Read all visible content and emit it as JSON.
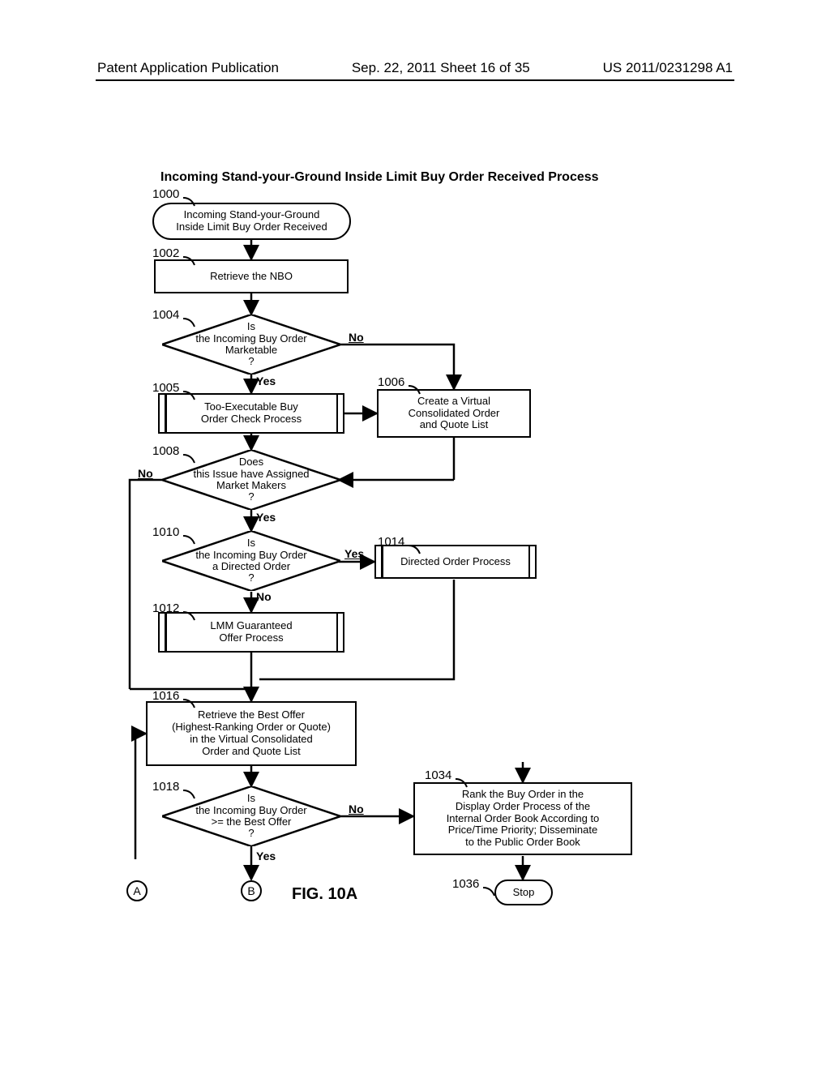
{
  "header": {
    "left": "Patent Application Publication",
    "mid": "Sep. 22, 2011  Sheet 16 of 35",
    "right": "US 2011/0231298 A1"
  },
  "title": "Incoming Stand-your-Ground Inside Limit Buy Order Received Process",
  "refs": {
    "r1000": "1000",
    "r1002": "1002",
    "r1004": "1004",
    "r1005": "1005",
    "r1006": "1006",
    "r1008": "1008",
    "r1010": "1010",
    "r1012": "1012",
    "r1014": "1014",
    "r1016": "1016",
    "r1018": "1018",
    "r1034": "1034",
    "r1036": "1036"
  },
  "nodes": {
    "n1000": "Incoming Stand-your-Ground\nInside Limit Buy Order Received",
    "n1002": "Retrieve the NBO",
    "n1004": "Is\nthe Incoming Buy Order\nMarketable\n?",
    "n1005": "Too-Executable Buy\nOrder Check Process",
    "n1006": "Create a Virtual\nConsolidated Order\nand Quote List",
    "n1008": "Does\nthis Issue have Assigned\nMarket Makers\n?",
    "n1010": "Is\nthe Incoming Buy Order\na Directed Order\n?",
    "n1012": "LMM Guaranteed\nOffer Process",
    "n1014": "Directed Order Process",
    "n1016": "Retrieve the Best Offer\n(Highest-Ranking Order or Quote)\nin the Virtual Consolidated\nOrder and Quote List",
    "n1018": "Is\nthe Incoming Buy Order\n>= the Best Offer\n?",
    "n1034": "Rank the Buy Order in the\nDisplay Order Process of the\nInternal Order Book According to\nPrice/Time Priority; Disseminate\nto the Public Order Book",
    "n1036": "Stop"
  },
  "labels": {
    "yes": "Yes",
    "no": "No"
  },
  "connectors": {
    "a": "A",
    "b": "B"
  },
  "figure": "FIG. 10A"
}
